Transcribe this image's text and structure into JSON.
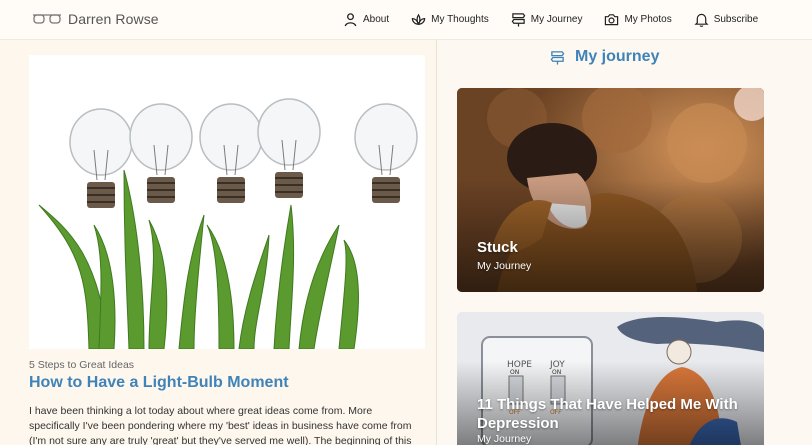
{
  "header": {
    "brand_name": "Darren Rowse",
    "nav": [
      {
        "label": "About",
        "icon": "person-icon"
      },
      {
        "label": "My Thoughts",
        "icon": "lotus-icon"
      },
      {
        "label": "My Journey",
        "icon": "signpost-icon"
      },
      {
        "label": "My Photos",
        "icon": "camera-icon"
      },
      {
        "label": "Subscribe",
        "icon": "bell-icon"
      }
    ]
  },
  "featured": {
    "kicker": "5 Steps to Great Ideas",
    "title": "How to Have a Light-Bulb Moment",
    "excerpt": "I have been thinking a lot today about where great ideas come from. More specifically I've been pondering where my 'best' ideas in business have come from (I'm not sure any are truly 'great' but they've served me well). The beginning of this"
  },
  "sidebar": {
    "section_title": "My journey",
    "cards": [
      {
        "title": "Stuck",
        "category": "My Journey"
      },
      {
        "title": "11 Things That Have Helped Me With Depression",
        "category": "My Journey"
      }
    ]
  },
  "colors": {
    "accent": "#3f83b8",
    "background": "#fdf8f1"
  }
}
